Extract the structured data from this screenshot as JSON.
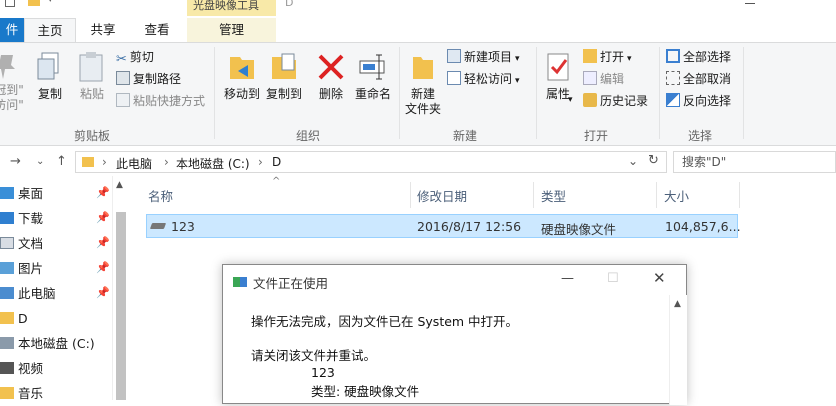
{
  "titlebar": {
    "context_tab": "光盘映像工具",
    "path": "D"
  },
  "tabs": {
    "file": "件",
    "home": "主页",
    "share": "共享",
    "view": "查看",
    "manage": "管理"
  },
  "ribbon": {
    "clipboard": {
      "pin_label_1": "冠到\"",
      "pin_label_2": "访问\"",
      "copy": "复制",
      "paste": "粘贴",
      "cut": "剪切",
      "copy_path": "复制路径",
      "paste_shortcut": "粘贴快捷方式",
      "group": "剪贴板"
    },
    "organize": {
      "move_to": "移动到",
      "copy_to": "复制到",
      "delete": "删除",
      "rename": "重命名",
      "group": "组织"
    },
    "new": {
      "new_folder_1": "新建",
      "new_folder_2": "文件夹",
      "new_item": "新建项目",
      "easy_access": "轻松访问",
      "group": "新建"
    },
    "open": {
      "properties": "属性",
      "open": "打开",
      "edit": "编辑",
      "history": "历史记录",
      "group": "打开"
    },
    "select": {
      "select_all": "全部选择",
      "select_none": "全部取消",
      "invert": "反向选择",
      "group": "选择"
    }
  },
  "address": {
    "crumbs": [
      "此电脑",
      "本地磁盘 (C:)",
      "D"
    ],
    "search_placeholder": "搜索\"D\""
  },
  "navpane": {
    "items": [
      {
        "label": "桌面",
        "pinned": true
      },
      {
        "label": "下载",
        "pinned": true
      },
      {
        "label": "文档",
        "pinned": true
      },
      {
        "label": "图片",
        "pinned": true
      },
      {
        "label": "此电脑",
        "pinned": true
      },
      {
        "label": "D",
        "pinned": false
      },
      {
        "label": "本地磁盘 (C:)",
        "pinned": false
      },
      {
        "label": "视频",
        "pinned": false
      },
      {
        "label": "音乐",
        "pinned": false
      }
    ]
  },
  "filelist": {
    "columns": {
      "name": "名称",
      "date": "修改日期",
      "type": "类型",
      "size": "大小"
    },
    "rows": [
      {
        "name": "123",
        "date": "2016/8/17 12:56",
        "type": "硬盘映像文件",
        "size": "104,857,6..."
      }
    ]
  },
  "dialog": {
    "title": "文件正在使用",
    "message": "操作无法完成，因为文件已在 System 中打开。",
    "instruction": "请关闭该文件并重试。",
    "file_name": "123",
    "file_type": "类型: 硬盘映像文件"
  },
  "colors": {
    "accent": "#1979ca",
    "selection": "#cce8ff",
    "context_tab": "#f8e9a8"
  }
}
